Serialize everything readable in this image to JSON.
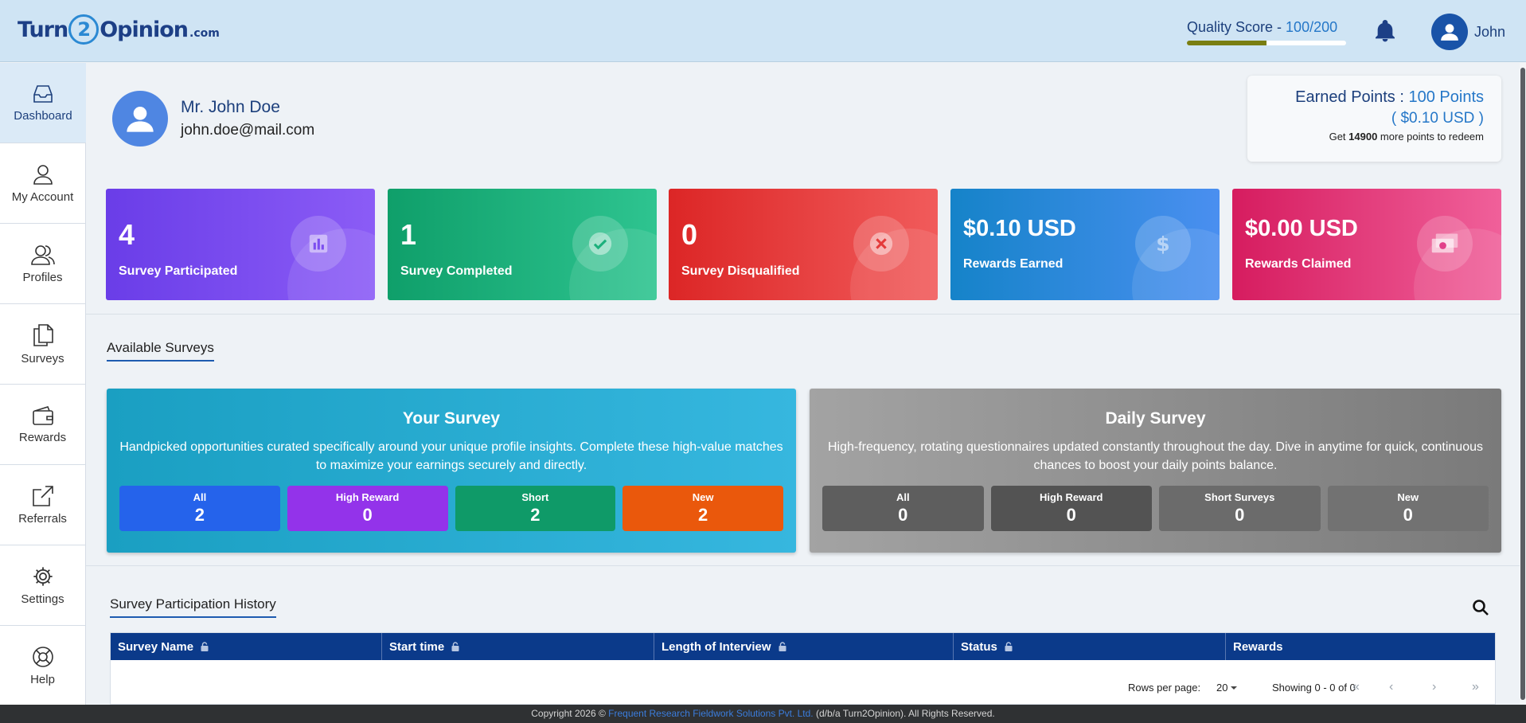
{
  "header": {
    "logo_text": "Turn2Opinion.com",
    "quality_score_label": "Quality Score - ",
    "quality_score_value": "100/200",
    "quality_score_fraction": 0.5,
    "user_name": "John"
  },
  "sidebar": {
    "items": [
      {
        "label": "Dashboard",
        "icon": "inbox-icon",
        "active": true
      },
      {
        "label": "My Account",
        "icon": "user-icon"
      },
      {
        "label": "Profiles",
        "icon": "users-icon"
      },
      {
        "label": "Surveys",
        "icon": "documents-icon"
      },
      {
        "label": "Rewards",
        "icon": "wallet-icon"
      },
      {
        "label": "Referrals",
        "icon": "share-icon"
      },
      {
        "label": "Settings",
        "icon": "gear-icon"
      },
      {
        "label": "Help",
        "icon": "lifebuoy-icon"
      }
    ]
  },
  "profile": {
    "name": "Mr. John Doe",
    "email": "john.doe@mail.com"
  },
  "earned": {
    "label": "Earned Points : ",
    "points": "100 Points",
    "usd": "( $0.10 USD )",
    "redeem_prefix": "Get ",
    "redeem_points": "14900",
    "redeem_suffix": " more points to redeem"
  },
  "stats": [
    {
      "value": "4",
      "label": "Survey Participated",
      "icon": "chart-icon",
      "colors": [
        "#6a3de8",
        "#8b5cf6"
      ]
    },
    {
      "value": "1",
      "label": "Survey Completed",
      "icon": "check-circle-icon",
      "colors": [
        "#0f9f6a",
        "#2ec490"
      ]
    },
    {
      "value": "0",
      "label": "Survey Disqualified",
      "icon": "x-circle-icon",
      "colors": [
        "#dc2626",
        "#f15b5b"
      ]
    },
    {
      "value": "$0.10 USD",
      "label": "Rewards Earned",
      "icon": "dollar-icon",
      "colors": [
        "#1583c9",
        "#4a8ff0"
      ]
    },
    {
      "value": "$0.00 USD",
      "label": "Rewards Claimed",
      "icon": "money-icon",
      "colors": [
        "#d61c5f",
        "#f0609a"
      ]
    }
  ],
  "available": {
    "title": "Available Surveys",
    "your_survey": {
      "title": "Your Survey",
      "description": "Handpicked opportunities curated specifically around your unique profile insights. Complete these high-value matches to maximize your earnings securely and directly.",
      "pills": [
        {
          "label": "All",
          "value": "2",
          "color": "#2563eb"
        },
        {
          "label": "High Reward",
          "value": "0",
          "color": "#9333ea"
        },
        {
          "label": "Short",
          "value": "2",
          "color": "#0f9a68"
        },
        {
          "label": "New",
          "value": "2",
          "color": "#ea580c"
        }
      ]
    },
    "daily_survey": {
      "title": "Daily Survey",
      "description": "High-frequency, rotating questionnaires updated constantly throughout the day. Dive in anytime for quick, continuous chances to boost your daily points balance.",
      "pills": [
        {
          "label": "All",
          "value": "0",
          "color": "#5e5e5e"
        },
        {
          "label": "High Reward",
          "value": "0",
          "color": "#535353"
        },
        {
          "label": "Short Surveys",
          "value": "0",
          "color": "#6b6b6b"
        },
        {
          "label": "New",
          "value": "0",
          "color": "#727272"
        }
      ]
    }
  },
  "history": {
    "title": "Survey Participation History",
    "columns": [
      "Survey Name",
      "Start time",
      "Length of Interview",
      "Status",
      "Rewards"
    ],
    "rows_per_page_label": "Rows per page:",
    "rows_per_page_value": "20",
    "showing": "Showing 0 - 0 of 0"
  },
  "footer": {
    "prefix": "Copyright 2026 © ",
    "link": "Frequent Research Fieldwork Solutions Pvt. Ltd.",
    "suffix": " (d/b/a Turn2Opinion). All Rights Reserved."
  }
}
